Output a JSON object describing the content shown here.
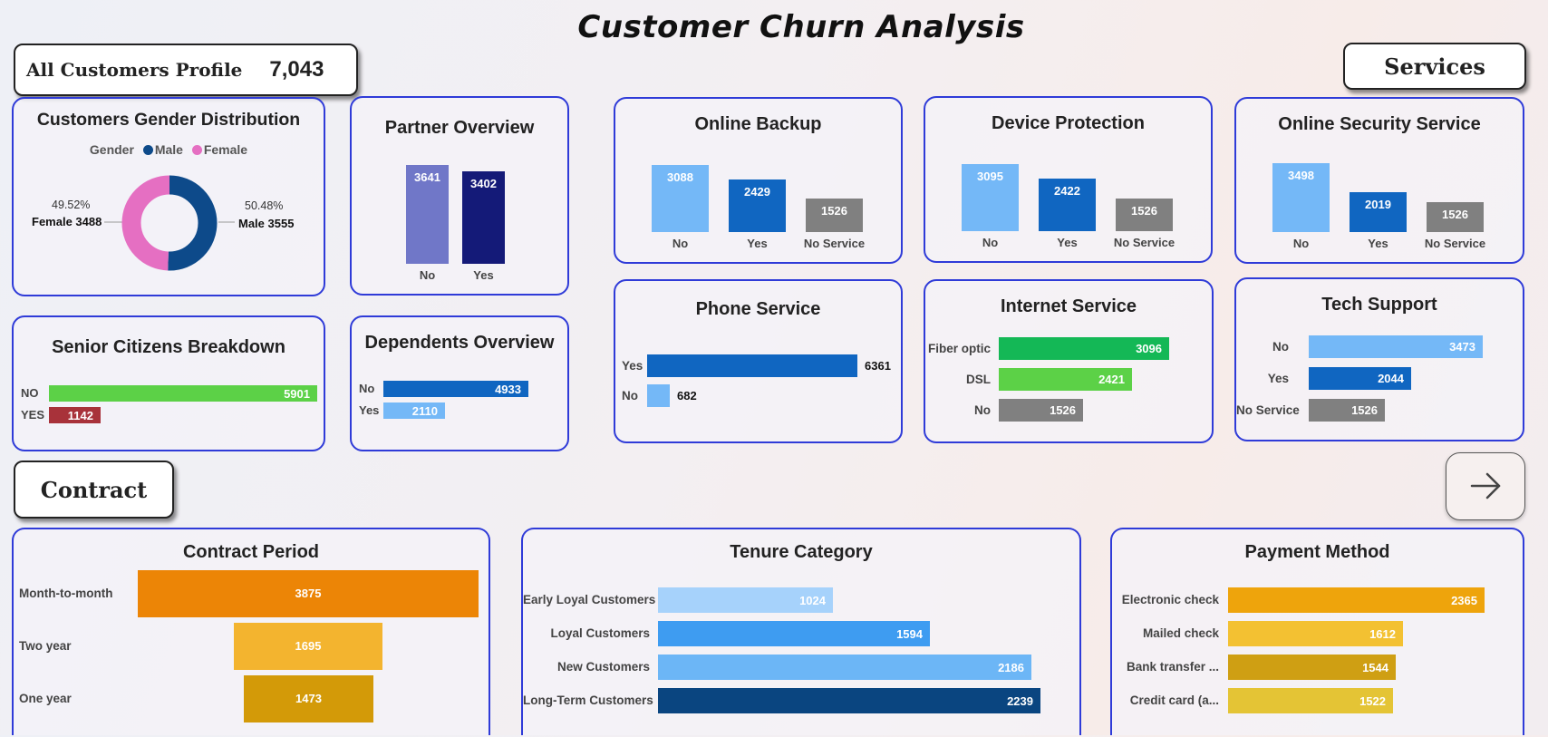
{
  "title": "Customer Churn Analysis",
  "profile": {
    "label": "All Customers Profile",
    "count": "7,043"
  },
  "section_services": "Services",
  "section_contract": "Contract",
  "gender": {
    "title": "Customers Gender Distribution",
    "legend_title": "Gender",
    "legend_male": "Male",
    "legend_female": "Female",
    "female_pct": "49.52%",
    "female_label": "Female 3488",
    "male_pct": "50.48%",
    "male_label": "Male 3555",
    "male_fraction": 0.5048,
    "colors": {
      "male": "#0d4a8a",
      "female": "#e56fc2"
    }
  },
  "partner": {
    "title": "Partner Overview",
    "bars": [
      {
        "label": "No",
        "value": 3641,
        "color": "#7077c8"
      },
      {
        "label": "Yes",
        "value": 3402,
        "color": "#141a78"
      }
    ]
  },
  "senior": {
    "title": "Senior Citizens Breakdown",
    "bars": [
      {
        "label": "NO",
        "value": 5901,
        "color": "#5cd147"
      },
      {
        "label": "YES",
        "value": 1142,
        "color": "#a8323a"
      }
    ]
  },
  "dependents": {
    "title": "Dependents Overview",
    "bars": [
      {
        "label": "No",
        "value": 4933,
        "color": "#1066c1"
      },
      {
        "label": "Yes",
        "value": 2110,
        "color": "#74b8f7"
      }
    ]
  },
  "online_backup": {
    "title": "Online Backup",
    "bars": [
      {
        "label": "No",
        "value": 3088,
        "color": "#74b8f7"
      },
      {
        "label": "Yes",
        "value": 2429,
        "color": "#1066c1"
      },
      {
        "label": "No Service",
        "value": 1526,
        "color": "#808080"
      }
    ]
  },
  "device_protection": {
    "title": "Device Protection",
    "bars": [
      {
        "label": "No",
        "value": 3095,
        "color": "#74b8f7"
      },
      {
        "label": "Yes",
        "value": 2422,
        "color": "#1066c1"
      },
      {
        "label": "No Service",
        "value": 1526,
        "color": "#808080"
      }
    ]
  },
  "online_security": {
    "title": "Online Security Service",
    "bars": [
      {
        "label": "No",
        "value": 3498,
        "color": "#74b8f7"
      },
      {
        "label": "Yes",
        "value": 2019,
        "color": "#1066c1"
      },
      {
        "label": "No Service",
        "value": 1526,
        "color": "#808080"
      }
    ]
  },
  "phone_service": {
    "title": "Phone Service",
    "bars": [
      {
        "label": "Yes",
        "value": 6361,
        "color": "#1066c1"
      },
      {
        "label": "No",
        "value": 682,
        "color": "#74b8f7"
      }
    ]
  },
  "internet_service": {
    "title": "Internet Service",
    "bars": [
      {
        "label": "Fiber optic",
        "value": 3096,
        "color": "#14b856"
      },
      {
        "label": "DSL",
        "value": 2421,
        "color": "#5cd147"
      },
      {
        "label": "No",
        "value": 1526,
        "color": "#808080"
      }
    ]
  },
  "tech_support": {
    "title": "Tech Support",
    "bars": [
      {
        "label": "No",
        "value": 3473,
        "color": "#74b8f7"
      },
      {
        "label": "Yes",
        "value": 2044,
        "color": "#1066c1"
      },
      {
        "label": "No Service",
        "value": 1526,
        "color": "#808080"
      }
    ]
  },
  "contract": {
    "title": "Contract Period",
    "bars": [
      {
        "label": "Month-to-month",
        "value": 3875,
        "color": "#ec8506"
      },
      {
        "label": "Two year",
        "value": 1695,
        "color": "#f3b42f"
      },
      {
        "label": "One year",
        "value": 1473,
        "color": "#d39a08"
      }
    ]
  },
  "tenure": {
    "title": "Tenure Category",
    "bars": [
      {
        "label": "Early Loyal Customers",
        "value": 1024,
        "color": "#a6d2fb"
      },
      {
        "label": "Loyal Customers",
        "value": 1594,
        "color": "#3e9cf1"
      },
      {
        "label": "New Customers",
        "value": 2186,
        "color": "#6cb6f6"
      },
      {
        "label": "Long-Term Customers",
        "value": 2239,
        "color": "#0a4580"
      }
    ]
  },
  "payment": {
    "title": "Payment Method",
    "bars": [
      {
        "label": "Electronic check",
        "value": 2365,
        "color": "#eea40c"
      },
      {
        "label": "Mailed check",
        "value": 1612,
        "color": "#f3c132"
      },
      {
        "label": "Bank transfer ...",
        "value": 1544,
        "color": "#cf9f13"
      },
      {
        "label": "Credit card (a...",
        "value": 1522,
        "color": "#e4c435"
      }
    ]
  },
  "nav_icon": "arrow-right-icon"
}
